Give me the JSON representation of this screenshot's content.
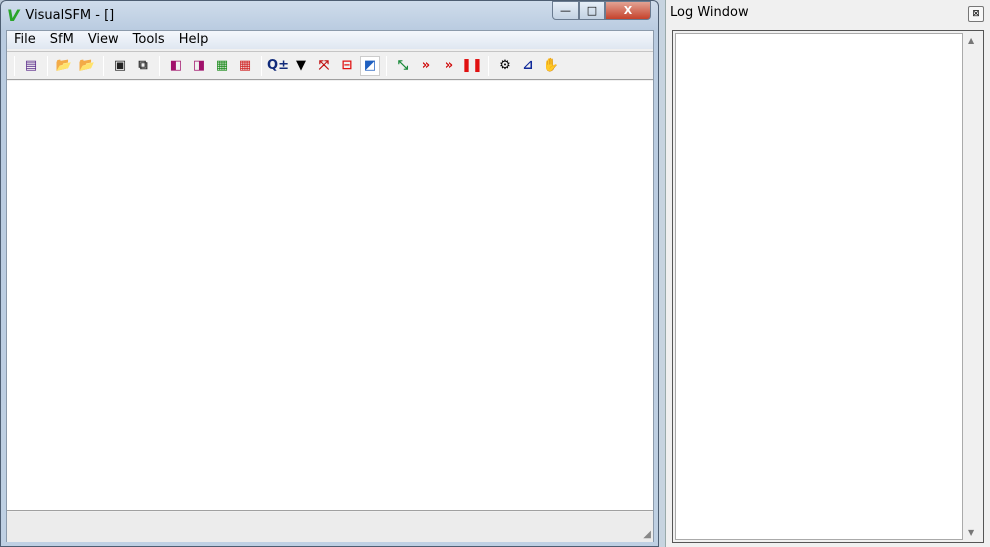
{
  "main_window": {
    "title": "VisualSFM - []",
    "logo": "V",
    "controls": {
      "minimize": "—",
      "maximize": "□",
      "close": "X"
    }
  },
  "menu": [
    "File",
    "SfM",
    "View",
    "Tools",
    "Help"
  ],
  "toolbar": [
    {
      "icon": "document-icon",
      "glyph": "▤",
      "color": "#5a2a8a"
    },
    {
      "sep": true
    },
    {
      "icon": "open-new-folder-icon",
      "glyph": "📂",
      "color": "#2a7a9a"
    },
    {
      "icon": "add-folder-icon",
      "glyph": "📂",
      "color": "#2a7a9a"
    },
    {
      "sep": true
    },
    {
      "icon": "save-icon",
      "glyph": "▣",
      "color": "#222"
    },
    {
      "icon": "copy-icon",
      "glyph": "⧉",
      "color": "#333"
    },
    {
      "sep": true
    },
    {
      "icon": "previous-icon",
      "glyph": "◧",
      "color": "#a0106a"
    },
    {
      "icon": "next-icon",
      "glyph": "◨",
      "color": "#a0106a"
    },
    {
      "icon": "2d-3d-icon",
      "glyph": "▦",
      "color": "#1a8a1a"
    },
    {
      "icon": "color-grid-icon",
      "glyph": "▦",
      "color": "#d02020"
    },
    {
      "sep": true
    },
    {
      "icon": "zoom-icon",
      "glyph": "Q±",
      "color": "#102a7a"
    },
    {
      "icon": "dropdown-icon",
      "glyph": "▼",
      "color": "#000"
    },
    {
      "icon": "axes-icon",
      "glyph": "⤧",
      "color": "#c01010"
    },
    {
      "icon": "frame-icon",
      "glyph": "⊟",
      "color": "#e01010"
    },
    {
      "icon": "cameras-icon",
      "glyph": "◩",
      "color": "#2060c0",
      "active": true
    },
    {
      "sep": true
    },
    {
      "icon": "match-icon",
      "glyph": "⤡",
      "color": "#1a8a3a"
    },
    {
      "icon": "reconstruct-icon",
      "glyph": "»",
      "color": "#d01010"
    },
    {
      "icon": "reconstruct-add-icon",
      "glyph": "»",
      "color": "#d01010"
    },
    {
      "icon": "pause-icon",
      "glyph": "❚❚",
      "color": "#e01010"
    },
    {
      "sep": true
    },
    {
      "icon": "gear-icon",
      "glyph": "⚙",
      "color": "#000"
    },
    {
      "icon": "ruler-icon",
      "glyph": "⊿",
      "color": "#102a9a"
    },
    {
      "icon": "hand-icon",
      "glyph": "✋",
      "color": "#777"
    }
  ],
  "log_window": {
    "title": "Log Window",
    "close": "⊠",
    "scroll_up": "▲",
    "scroll_down": "▼"
  }
}
